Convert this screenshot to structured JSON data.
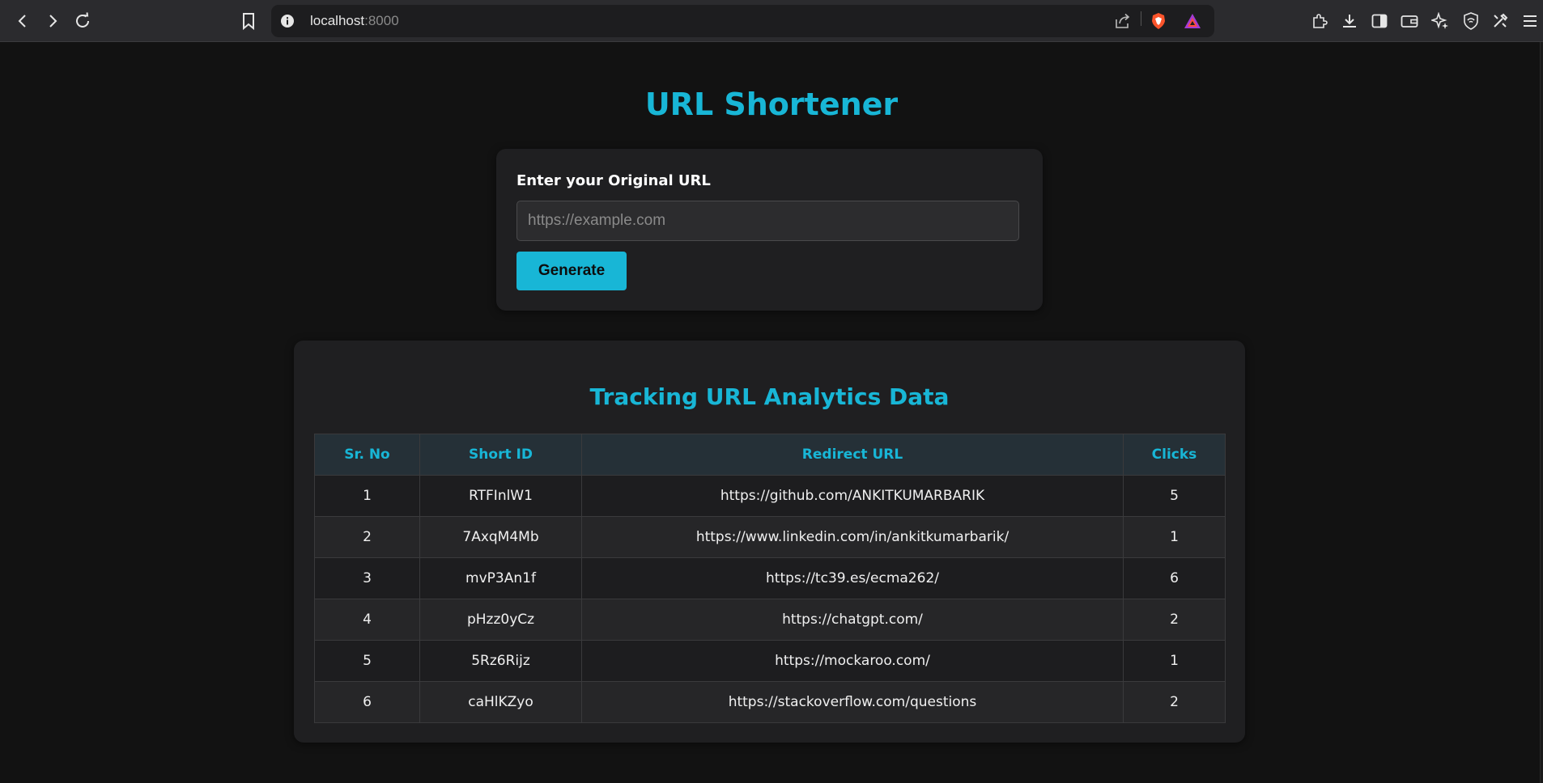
{
  "browser": {
    "address_host": "localhost",
    "address_port": ":8000",
    "icons": [
      "back-icon",
      "forward-icon",
      "reload-icon",
      "bookmark-icon",
      "site-info-icon",
      "share-icon",
      "brave-shields-icon",
      "brave-rewards-icon",
      "extensions-icon",
      "downloads-icon",
      "sidebar-icon",
      "wallet-icon",
      "leo-ai-icon",
      "vpn-icon",
      "settings-icon",
      "menu-icon"
    ]
  },
  "page": {
    "title": "URL Shortener",
    "form": {
      "label": "Enter your Original URL",
      "input_placeholder": "https://example.com",
      "input_value": "",
      "button_label": "Generate"
    },
    "analytics": {
      "title": "Tracking URL Analytics Data",
      "columns": [
        "Sr. No",
        "Short ID",
        "Redirect URL",
        "Clicks"
      ],
      "rows": [
        {
          "sr": "1",
          "short_id": "RTFInlW1",
          "redirect_url": "https://github.com/ANKITKUMARBARIK",
          "clicks": "5"
        },
        {
          "sr": "2",
          "short_id": "7AxqM4Mb",
          "redirect_url": "https://www.linkedin.com/in/ankitkumarbarik/",
          "clicks": "1"
        },
        {
          "sr": "3",
          "short_id": "mvP3An1f",
          "redirect_url": "https://tc39.es/ecma262/",
          "clicks": "6"
        },
        {
          "sr": "4",
          "short_id": "pHzz0yCz",
          "redirect_url": "https://chatgpt.com/",
          "clicks": "2"
        },
        {
          "sr": "5",
          "short_id": "5Rz6Rijz",
          "redirect_url": "https://mockaroo.com/",
          "clicks": "1"
        },
        {
          "sr": "6",
          "short_id": "caHlKZyo",
          "redirect_url": "https://stackoverflow.com/questions",
          "clicks": "2"
        }
      ]
    }
  },
  "colors": {
    "accent": "#18b6d6",
    "page_bg": "#121212",
    "card_bg": "#1f1f21",
    "header_bg": "#253037"
  }
}
